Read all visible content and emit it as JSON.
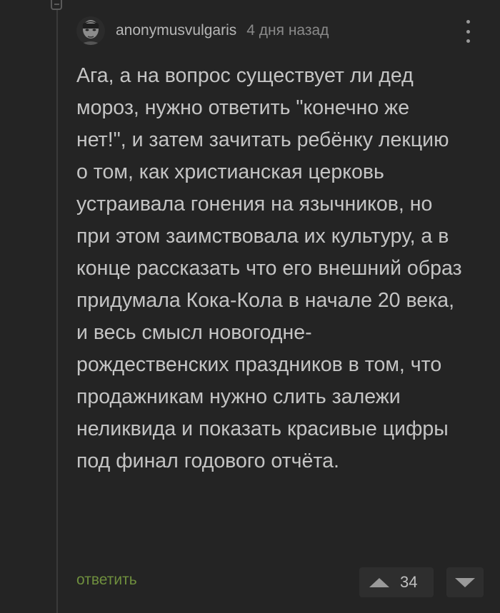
{
  "comment": {
    "username": "anonymusvulgaris",
    "time": "4 дня назад",
    "text": "Ага, а на вопрос существует ли дед мороз, нужно ответить \"конечно же нет!\", и затем зачитать ребёнку лекцию о том, как христианская церковь устраивала гонения на язычников, но при этом заимствовала их культуру, а в конце рассказать что его внешний образ придумала Кока-Кола в начале 20 века, и весь смысл новогодне-рождественских праздников в том, что продажникам нужно слить залежи неликвида и показать красивые цифры под финал годового отчёта."
  },
  "footer": {
    "reply_label": "ответить",
    "rating": "34"
  },
  "colors": {
    "background": "#242424",
    "text": "#c4c4c4",
    "reply": "#6f8f3e"
  },
  "icons": [
    "collapse-icon",
    "more-options-icon",
    "vote-up-icon",
    "vote-down-icon"
  ]
}
